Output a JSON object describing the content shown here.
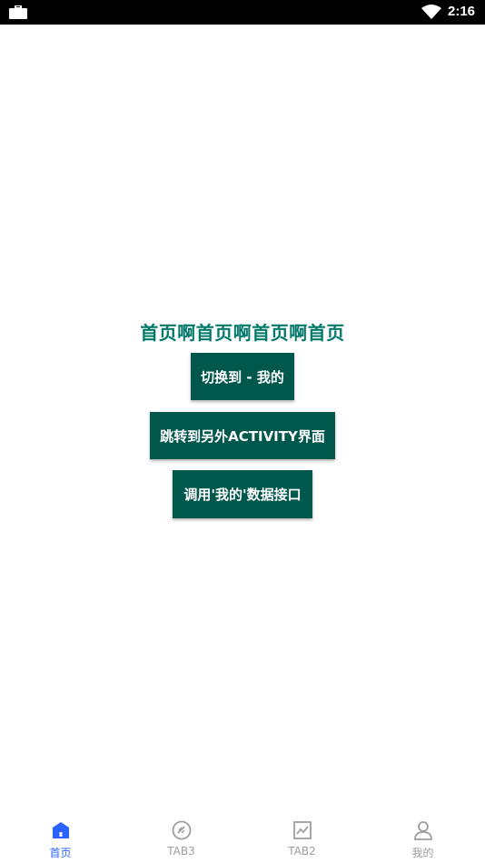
{
  "status_bar": {
    "time": "2:16",
    "left_icon": "briefcase-icon",
    "right_icon": "wifi-icon"
  },
  "main": {
    "headline": "首页啊首页啊首页啊首页",
    "buttons": {
      "switch_to_mine": "切换到 - 我的",
      "jump_activity": "跳转到另外ACTIVITY界面",
      "call_mine_api": "调用'我的'数据接口"
    },
    "headline_color": "#00796b",
    "button_color": "#00574b"
  },
  "bottom_nav": {
    "active_color": "#2962ff",
    "inactive_color": "#9e9e9e",
    "items": [
      {
        "label": "首页",
        "icon": "home-icon",
        "active": true
      },
      {
        "label": "TAB3",
        "icon": "compass-icon",
        "active": false
      },
      {
        "label": "TAB2",
        "icon": "chart-icon",
        "active": false
      },
      {
        "label": "我的",
        "icon": "person-icon",
        "active": false
      }
    ]
  }
}
